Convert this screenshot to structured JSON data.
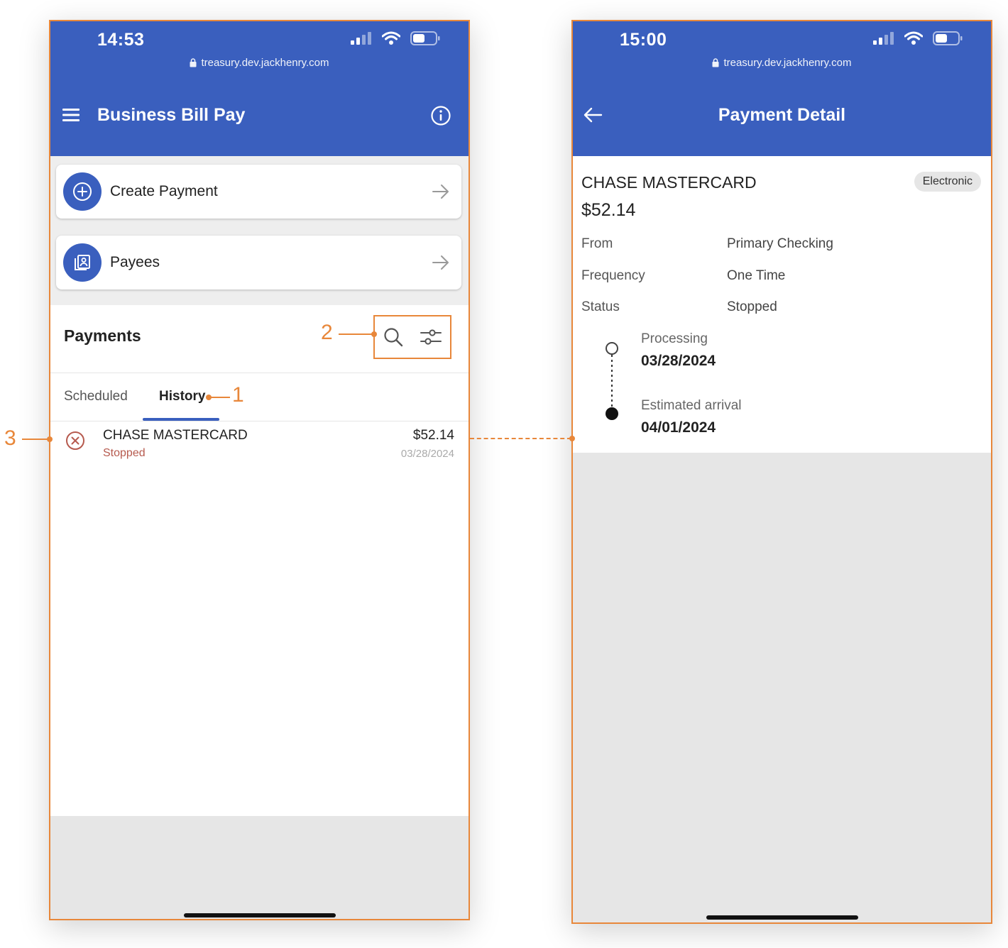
{
  "left_screen": {
    "status_time": "14:53",
    "url": "treasury.dev.jackhenry.com",
    "title": "Business Bill Pay",
    "actions": [
      {
        "label": "Create Payment"
      },
      {
        "label": "Payees"
      }
    ],
    "payments_title": "Payments",
    "tabs": [
      {
        "label": "Scheduled",
        "active": false
      },
      {
        "label": "History",
        "active": true
      }
    ],
    "rows": [
      {
        "payee": "CHASE MASTERCARD",
        "status": "Stopped",
        "amount": "$52.14",
        "date": "03/28/2024"
      }
    ]
  },
  "right_screen": {
    "status_time": "15:00",
    "url": "treasury.dev.jackhenry.com",
    "title": "Payment Detail",
    "payee": "CHASE MASTERCARD",
    "badge": "Electronic",
    "amount": "$52.14",
    "details": [
      {
        "key": "From",
        "value": "Primary Checking"
      },
      {
        "key": "Frequency",
        "value": "One Time"
      },
      {
        "key": "Status",
        "value": "Stopped"
      }
    ],
    "timeline": [
      {
        "label": "Processing",
        "date": "03/28/2024"
      },
      {
        "label": "Estimated arrival",
        "date": "04/01/2024"
      }
    ]
  },
  "annotations": [
    "1",
    "2",
    "3"
  ],
  "colors": {
    "primary": "#3a5fbe",
    "annotation": "#e8873a",
    "stopped": "#b65a4e"
  }
}
